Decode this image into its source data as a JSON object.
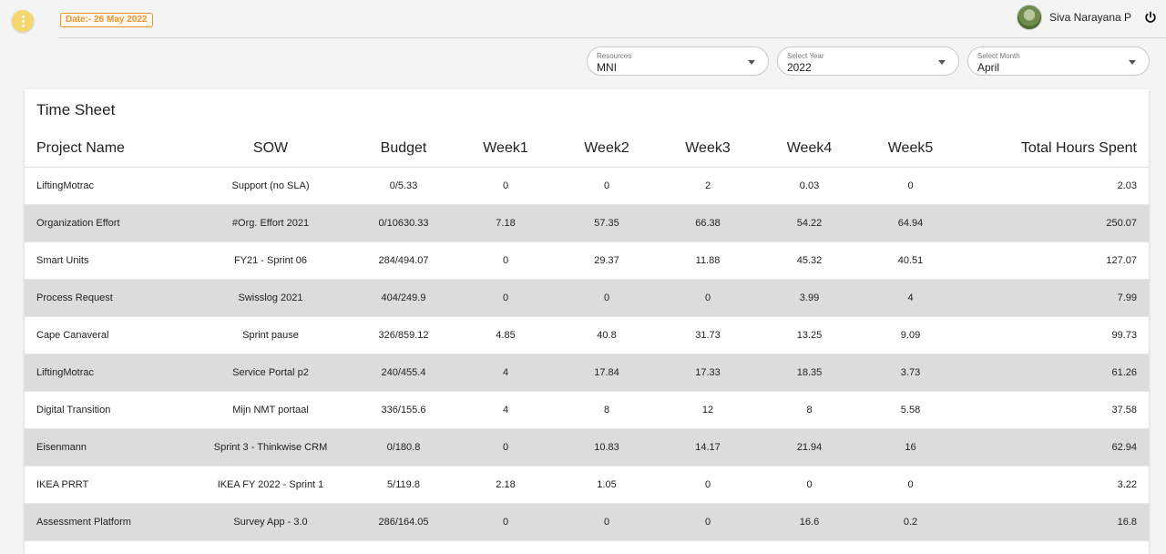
{
  "header": {
    "date_label": "Date:- 26 May 2022",
    "user_name": "Siva Narayana P"
  },
  "filters": [
    {
      "label": "Resources",
      "value": "MNI"
    },
    {
      "label": "Select Year",
      "value": "2022"
    },
    {
      "label": "Select Month",
      "value": "April"
    }
  ],
  "timesheet": {
    "title": "Time Sheet",
    "columns": [
      "Project Name",
      "SOW",
      "Budget",
      "Week1",
      "Week2",
      "Week3",
      "Week4",
      "Week5",
      "Total Hours Spent"
    ],
    "rows": [
      [
        "LiftingMotrac",
        "Support (no SLA)",
        "0/5.33",
        "0",
        "0",
        "2",
        "0.03",
        "0",
        "2.03"
      ],
      [
        "Organization Effort",
        "#Org. Effort 2021",
        "0/10630.33",
        "7.18",
        "57.35",
        "66.38",
        "54.22",
        "64.94",
        "250.07"
      ],
      [
        "Smart Units",
        "FY21 - Sprint 06",
        "284/494.07",
        "0",
        "29.37",
        "11.88",
        "45.32",
        "40.51",
        "127.07"
      ],
      [
        "Process Request",
        "Swisslog 2021",
        "404/249.9",
        "0",
        "0",
        "0",
        "3.99",
        "4",
        "7.99"
      ],
      [
        "Cape Canaveral",
        "Sprint pause",
        "326/859.12",
        "4.85",
        "40.8",
        "31.73",
        "13.25",
        "9.09",
        "99.73"
      ],
      [
        "LiftingMotrac",
        "Service Portal p2",
        "240/455.4",
        "4",
        "17.84",
        "17.33",
        "18.35",
        "3.73",
        "61.26"
      ],
      [
        "Digital Transition",
        "Mijn NMT portaal",
        "336/155.6",
        "4",
        "8",
        "12",
        "8",
        "5.58",
        "37.58"
      ],
      [
        "Eisenmann",
        "Sprint 3 - Thinkwise CRM",
        "0/180.8",
        "0",
        "10.83",
        "14.17",
        "21.94",
        "16",
        "62.94"
      ],
      [
        "IKEA PRRT",
        "IKEA FY 2022 - Sprint 1",
        "5/119.8",
        "2.18",
        "1.05",
        "0",
        "0",
        "0",
        "3.22"
      ],
      [
        "Assessment Platform",
        "Survey App - 3.0",
        "286/164.05",
        "0",
        "0",
        "0",
        "16.6",
        "0.2",
        "16.8"
      ]
    ]
  },
  "colors": {
    "accent": "#f0922b",
    "menu_button": "#f5d76e",
    "alt_row": "#dcdcdc"
  },
  "icons": [
    "more-vert-icon",
    "power-icon",
    "avatar",
    "caret-down-icon"
  ]
}
